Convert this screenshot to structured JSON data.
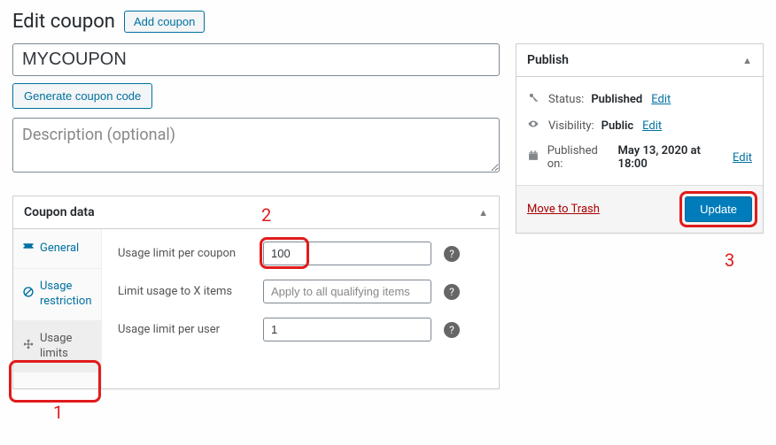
{
  "header": {
    "title": "Edit coupon",
    "add_button": "Add coupon"
  },
  "coupon": {
    "code": "MYCOUPON",
    "generate_button": "Generate coupon code",
    "description_placeholder": "Description (optional)"
  },
  "coupon_data": {
    "title": "Coupon data",
    "tabs": {
      "general": "General",
      "usage_restriction": "Usage restriction",
      "usage_limits": "Usage limits"
    },
    "fields": {
      "limit_per_coupon": {
        "label": "Usage limit per coupon",
        "value": "100"
      },
      "limit_x_items": {
        "label": "Limit usage to X items",
        "placeholder": "Apply to all qualifying items"
      },
      "limit_per_user": {
        "label": "Usage limit per user",
        "value": "1"
      }
    }
  },
  "publish": {
    "title": "Publish",
    "status_label": "Status:",
    "status_value": "Published",
    "visibility_label": "Visibility:",
    "visibility_value": "Public",
    "published_on_label": "Published on:",
    "published_on_value": "May 13, 2020 at 18:00",
    "edit": "Edit",
    "trash": "Move to Trash",
    "update": "Update"
  },
  "annotations": {
    "n1": "1",
    "n2": "2",
    "n3": "3"
  }
}
